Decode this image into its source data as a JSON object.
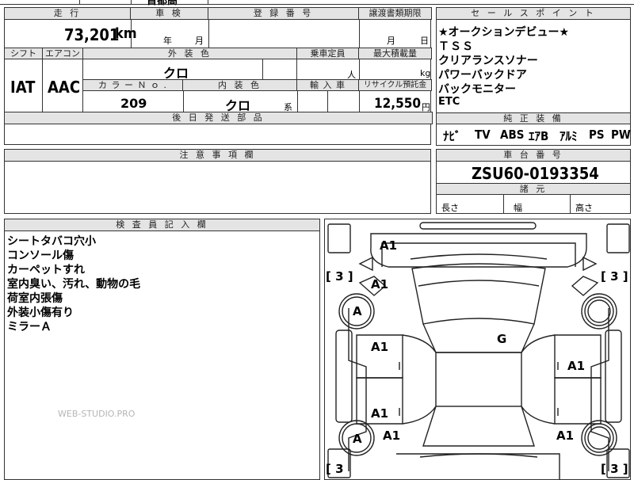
{
  "top_strip": {
    "partial_text": "首都高"
  },
  "header_row": {
    "mileage_label": "走 行",
    "inspection_label": "車 検",
    "registration_label": "登 録 番 号",
    "transfer_deadline_label": "譲渡書類期限",
    "selling_points_label": "セ ー ル ス ポ イ ン ト"
  },
  "mileage": {
    "value": "73,201",
    "unit": "km"
  },
  "inspection": {
    "year_unit": "年",
    "month_unit": "月"
  },
  "transfer": {
    "month_unit": "月",
    "day_unit": "日"
  },
  "row2": {
    "shift_label": "シフト",
    "ac_label": "エアコン",
    "exterior_color_label": "外 装 色",
    "capacity_label": "乗車定員",
    "max_load_label": "最大積載量"
  },
  "specs": {
    "shift": "IAT",
    "aircon": "AAC",
    "exterior_color": "クロ",
    "capacity_unit": "人",
    "load_unit": "kg"
  },
  "row3": {
    "color_no_label": "カ ラ ー Ｎ ｏ .",
    "interior_color_label": "内 装 色",
    "import_label": "輸 入 車",
    "recycle_label": "リサイクル預託金"
  },
  "specs2": {
    "color_no": "209",
    "interior_color": "クロ",
    "interior_suffix": "系",
    "recycle_amount": "12,550",
    "recycle_unit": "円"
  },
  "later_parts_label": "後 日 発 送 部 品",
  "selling_points": [
    "★オークションデビュー★",
    "ＴＳＳ",
    "クリアランスソナー",
    "パワーバックドア",
    "バックモニター",
    "ETC"
  ],
  "equipment_label": "純 正 装 備",
  "equipment": [
    "ﾅﾋﾞ",
    "TV",
    "ABS",
    "ｴｱB",
    "ｱﾙﾐ",
    "PS",
    "PW"
  ],
  "notes_label": "注 意 事 項 欄",
  "chassis_label": "車 台 番 号",
  "chassis_number": "ZSU60-0193354",
  "dimensions_label": "諸 元",
  "dimensions": {
    "length": "長さ",
    "width": "幅",
    "height": "高さ"
  },
  "inspector_label": "検 査 員 記 入 欄",
  "inspector_notes": [
    "シートタバコ穴小",
    "コンソール傷",
    "カーペットすれ",
    "室内臭い、汚れ、動物の毛",
    "荷室内張傷",
    "外装小傷有り",
    "ミラーＡ"
  ],
  "watermark": "WEB-STUDIO.PRO",
  "car_marks": {
    "front": "A1",
    "front_left": "A1",
    "left_wheel_front": "A",
    "left_front_door": "A1",
    "left_rear_door": "A1",
    "left_wheel_rear": "A",
    "left_rear": "A1",
    "roof": "G",
    "right_door": "A1",
    "right_rear": "A1",
    "tl_bracket": "[ 3 ]",
    "tr_bracket": "[ 3 ]",
    "bl_bracket": "[ 3",
    "br_bracket": "[ 3 ]"
  }
}
